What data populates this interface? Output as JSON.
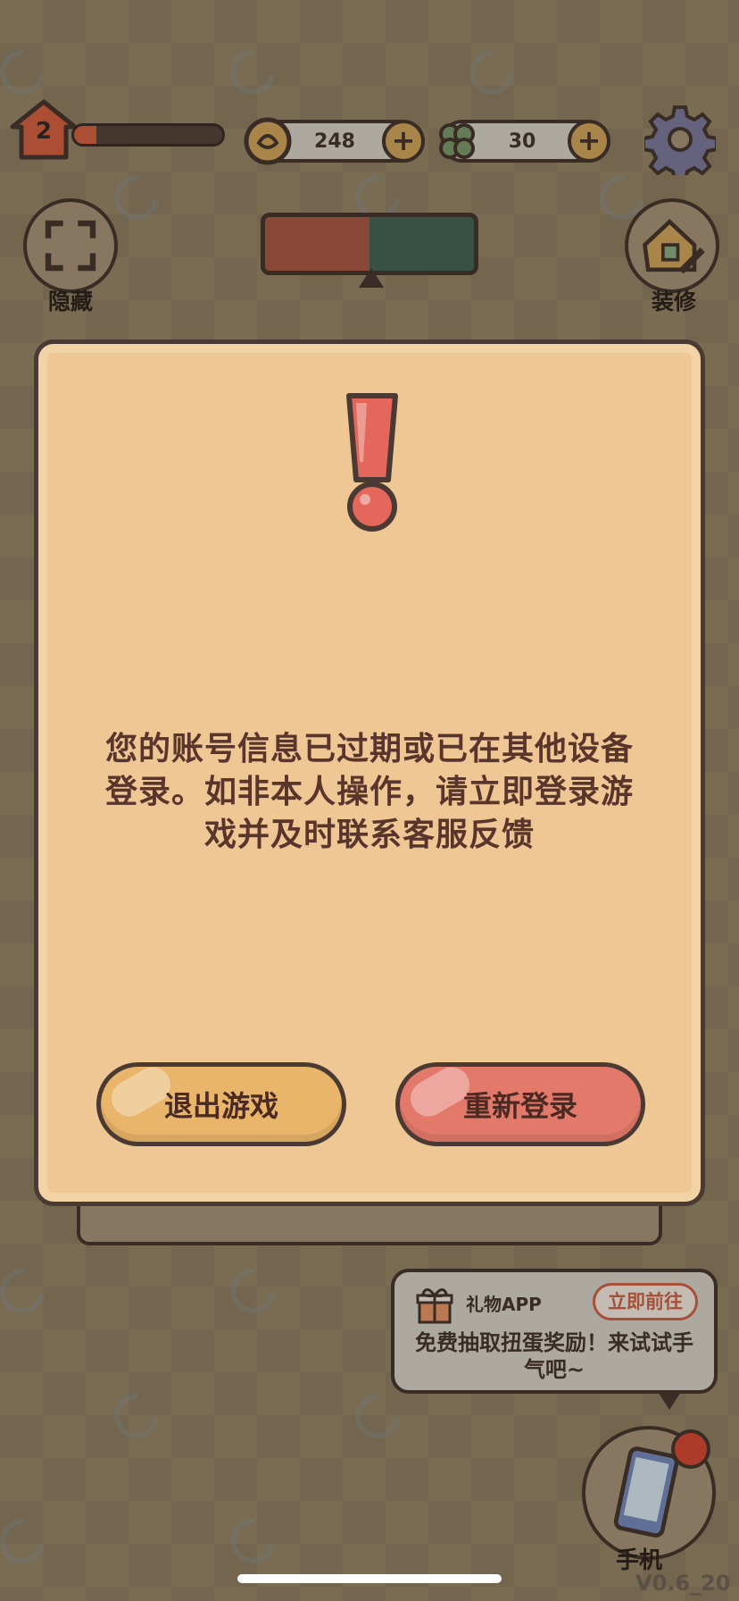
{
  "hud": {
    "level": "2",
    "xp_progress": 0.15,
    "coins": "248",
    "clovers": "30",
    "plus": "+",
    "settings_icon": "gear-icon"
  },
  "side": {
    "hide_label": "隐藏",
    "decorate_label": "装修",
    "phone_label": "手机"
  },
  "dialog": {
    "message": "您的账号信息已过期或已在其他设备登录。如非本人操作，请立即登录游戏并及时联系客服反馈",
    "exit_label": "退出游戏",
    "relogin_label": "重新登录",
    "icon": "exclamation-icon"
  },
  "gift": {
    "title": "礼物APP",
    "go_label": "立即前往",
    "desc": "免费抽取扭蛋奖励！来试试手气吧~"
  },
  "version": "V0.6_20",
  "colors": {
    "dialog_bg": "#eec795",
    "exit_btn": "#e9b56a",
    "relogin_btn": "#e3796a",
    "text_dark": "#5a352c"
  }
}
